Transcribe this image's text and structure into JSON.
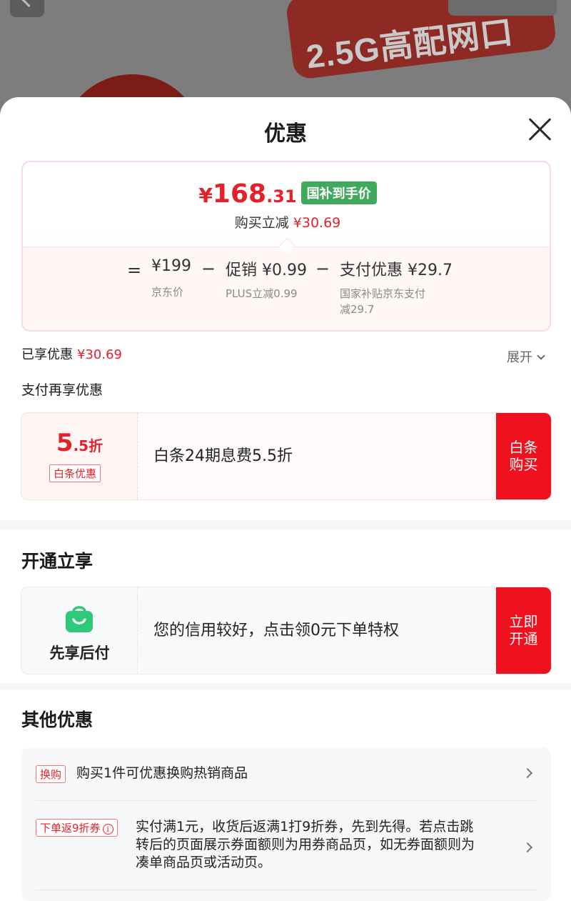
{
  "background": {
    "promo_text": "2.5G高配网口"
  },
  "sheet": {
    "title": "优惠"
  },
  "price_card": {
    "currency": "¥",
    "price_int": "168",
    "price_dec": ".31",
    "badge": "国补到手价",
    "reduce_label": "购买立减",
    "reduce_value": "¥30.69",
    "breakdown": {
      "equals": "=",
      "jd_price_value": "¥199",
      "jd_price_label": "京东价",
      "minus": "−",
      "promo_value": "促销 ¥0.99",
      "promo_label": "PLUS立减0.99",
      "pay_value": "支付优惠 ¥29.7",
      "pay_label_1": "国家补贴京东支付",
      "pay_label_2": "减29.7"
    }
  },
  "enjoyed": {
    "label": "已享优惠",
    "value": "¥30.69",
    "expand": "展开"
  },
  "pay_more": {
    "title": "支付再享优惠",
    "offer": {
      "discount_num": "5",
      "discount_suffix": ".5折",
      "tag": "白条优惠",
      "desc": "白条24期息费5.5折",
      "button_line1": "白条",
      "button_line2": "购买"
    }
  },
  "open_enjoy": {
    "title": "开通立享",
    "offer": {
      "icon": "shopping-bag-icon",
      "label": "先享后付",
      "desc": "您的信用较好，点击领0元下单特权",
      "button_line1": "立即",
      "button_line2": "开通"
    }
  },
  "other": {
    "title": "其他优惠",
    "rows": [
      {
        "tag": "换购",
        "text": "购买1件可优惠换购热销商品"
      },
      {
        "tag": "下单返9折券",
        "text_line1": "实付满1元，收货后返满1打9折券，先到先得。若点击跳",
        "text_line2": "转后的页面展示券面额则为用券商品页，如无券面额则为",
        "text_line3": "凑单商品页或活动页。"
      }
    ]
  },
  "colors": {
    "accent_red": "#e4202b",
    "button_red": "#f0111f",
    "badge_green": "#41a95c",
    "bag_green": "#2fc97a"
  }
}
